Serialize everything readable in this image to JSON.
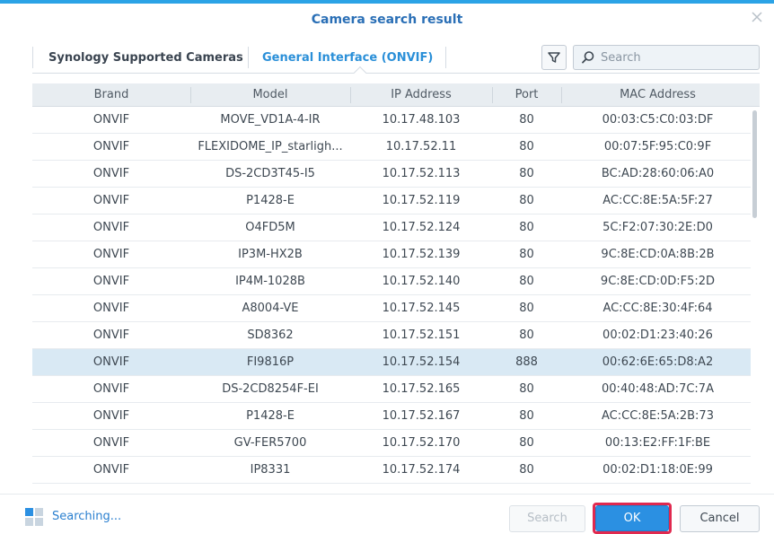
{
  "dialog": {
    "title": "Camera search result"
  },
  "tabs": [
    {
      "label": "Synology Supported Cameras"
    },
    {
      "label": "General Interface (ONVIF)"
    }
  ],
  "search": {
    "placeholder": "Search"
  },
  "table": {
    "columns": [
      "Brand",
      "Model",
      "IP Address",
      "Port",
      "MAC Address"
    ],
    "rows": [
      {
        "brand": "ONVIF",
        "model": "MOVE_VD1A-4-IR",
        "ip": "10.17.48.103",
        "port": "80",
        "mac": "00:03:C5:C0:03:DF"
      },
      {
        "brand": "ONVIF",
        "model": "FLEXIDOME_IP_starligh...",
        "ip": "10.17.52.11",
        "port": "80",
        "mac": "00:07:5F:95:C0:9F"
      },
      {
        "brand": "ONVIF",
        "model": "DS-2CD3T45-I5",
        "ip": "10.17.52.113",
        "port": "80",
        "mac": "BC:AD:28:60:06:A0"
      },
      {
        "brand": "ONVIF",
        "model": "P1428-E",
        "ip": "10.17.52.119",
        "port": "80",
        "mac": "AC:CC:8E:5A:5F:27"
      },
      {
        "brand": "ONVIF",
        "model": "O4FD5M",
        "ip": "10.17.52.124",
        "port": "80",
        "mac": "5C:F2:07:30:2E:D0"
      },
      {
        "brand": "ONVIF",
        "model": "IP3M-HX2B",
        "ip": "10.17.52.139",
        "port": "80",
        "mac": "9C:8E:CD:0A:8B:2B"
      },
      {
        "brand": "ONVIF",
        "model": "IP4M-1028B",
        "ip": "10.17.52.140",
        "port": "80",
        "mac": "9C:8E:CD:0D:F5:2D"
      },
      {
        "brand": "ONVIF",
        "model": "A8004-VE",
        "ip": "10.17.52.145",
        "port": "80",
        "mac": "AC:CC:8E:30:4F:64"
      },
      {
        "brand": "ONVIF",
        "model": "SD8362",
        "ip": "10.17.52.151",
        "port": "80",
        "mac": "00:02:D1:23:40:26"
      },
      {
        "brand": "ONVIF",
        "model": "FI9816P",
        "ip": "10.17.52.154",
        "port": "888",
        "mac": "00:62:6E:65:D8:A2"
      },
      {
        "brand": "ONVIF",
        "model": "DS-2CD8254F-EI",
        "ip": "10.17.52.165",
        "port": "80",
        "mac": "00:40:48:AD:7C:7A"
      },
      {
        "brand": "ONVIF",
        "model": "P1428-E",
        "ip": "10.17.52.167",
        "port": "80",
        "mac": "AC:CC:8E:5A:2B:73"
      },
      {
        "brand": "ONVIF",
        "model": "GV-FER5700",
        "ip": "10.17.52.170",
        "port": "80",
        "mac": "00:13:E2:FF:1F:BE"
      },
      {
        "brand": "ONVIF",
        "model": "IP8331",
        "ip": "10.17.52.174",
        "port": "80",
        "mac": "00:02:D1:18:0E:99"
      }
    ],
    "selected_model": "FI9816P"
  },
  "footer": {
    "status_text": "Searching...",
    "search_label": "Search",
    "ok_label": "OK",
    "cancel_label": "Cancel"
  },
  "colors": {
    "accent": "#2b90e2",
    "title": "#2a6fb6",
    "highlight_outline": "#e0294f",
    "selected_row": "#d9e9f4"
  },
  "icons": [
    "close-icon",
    "filter-icon",
    "search-icon",
    "searching-icon"
  ]
}
